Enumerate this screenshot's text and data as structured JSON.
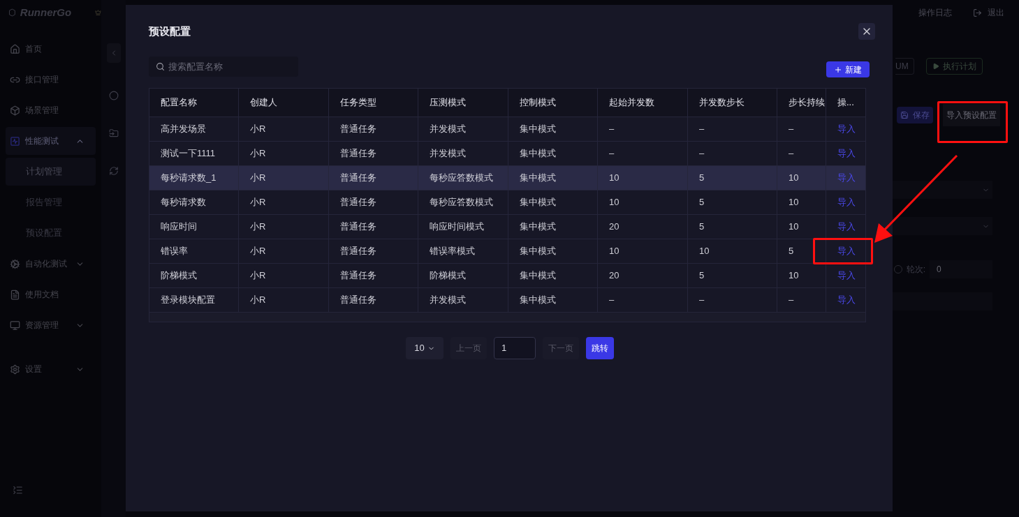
{
  "app": {
    "logo": "RunnerGo"
  },
  "top_bar": {
    "log_link": "操作日志",
    "logout": "退出"
  },
  "sidebar": {
    "items": [
      {
        "label": "首页",
        "kind": "home",
        "selected": false
      },
      {
        "label": "接口管理",
        "kind": "link",
        "selected": false
      },
      {
        "label": "场景管理",
        "kind": "cube",
        "selected": false
      },
      {
        "label": "性能测试",
        "kind": "perf",
        "selected": true,
        "expanded": true,
        "children": [
          {
            "label": "计划管理",
            "selected": true
          },
          {
            "label": "报告管理",
            "selected": false
          },
          {
            "label": "预设配置",
            "selected": false
          }
        ]
      },
      {
        "label": "自动化测试",
        "kind": "gear",
        "selected": false,
        "expanded": false
      },
      {
        "label": "使用文档",
        "kind": "doc",
        "selected": false
      },
      {
        "label": "资源管理",
        "kind": "monitor",
        "selected": false,
        "expanded": false
      },
      {
        "label": "设置",
        "kind": "settings",
        "selected": false,
        "expanded": false
      }
    ]
  },
  "plan_panel": {
    "partial_button": "UM",
    "run_button": "执行计划",
    "save_button": "保存",
    "import_button": "导入预设配置",
    "round_label": "轮次:",
    "round_checked": false,
    "round_value": "0"
  },
  "modal": {
    "title": "预设配置",
    "search": {
      "placeholder": "搜索配置名称"
    },
    "new_button": "新建",
    "table": {
      "columns": [
        "配置名称",
        "创建人",
        "任务类型",
        "压测模式",
        "控制模式",
        "起始并发数",
        "并发数步长",
        "步长持续",
        "操..."
      ],
      "rows": [
        {
          "cells": [
            "高并发场景",
            "小R",
            "普通任务",
            "并发模式",
            "集中模式",
            "–",
            "–",
            "–"
          ],
          "action": "导入",
          "hovered": false
        },
        {
          "cells": [
            "测试一下1111",
            "小R",
            "普通任务",
            "并发模式",
            "集中模式",
            "–",
            "–",
            "–"
          ],
          "action": "导入",
          "hovered": false
        },
        {
          "cells": [
            "每秒请求数_1",
            "小R",
            "普通任务",
            "每秒应答数模式",
            "集中模式",
            "10",
            "5",
            "10"
          ],
          "action": "导入",
          "hovered": true
        },
        {
          "cells": [
            "每秒请求数",
            "小R",
            "普通任务",
            "每秒应答数模式",
            "集中模式",
            "10",
            "5",
            "10"
          ],
          "action": "导入",
          "hovered": false
        },
        {
          "cells": [
            "响应时间",
            "小R",
            "普通任务",
            "响应时间模式",
            "集中模式",
            "20",
            "5",
            "10"
          ],
          "action": "导入",
          "hovered": false
        },
        {
          "cells": [
            "错误率",
            "小R",
            "普通任务",
            "错误率模式",
            "集中模式",
            "10",
            "10",
            "5"
          ],
          "action": "导入",
          "hovered": false
        },
        {
          "cells": [
            "阶梯模式",
            "小R",
            "普通任务",
            "阶梯模式",
            "集中模式",
            "20",
            "5",
            "10"
          ],
          "action": "导入",
          "hovered": false
        },
        {
          "cells": [
            "登录模块配置",
            "小R",
            "普通任务",
            "并发模式",
            "集中模式",
            "–",
            "–",
            "–"
          ],
          "action": "导入",
          "hovered": false
        }
      ]
    },
    "pagination": {
      "page_size": "10",
      "prev": "上一页",
      "prev_disabled": true,
      "page": "1",
      "next": "下一页",
      "next_disabled": true,
      "jump": "跳转"
    }
  }
}
